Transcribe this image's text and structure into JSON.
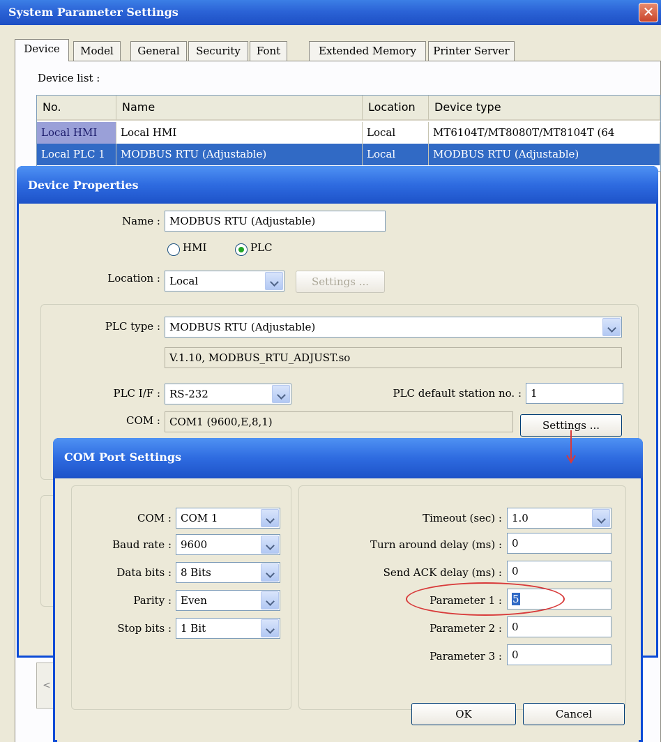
{
  "window": {
    "title": "System Parameter Settings",
    "close_glyph": "✕",
    "tabs": [
      "Device",
      "Model",
      "General",
      "Security",
      "Font",
      "Extended Memory",
      "Printer Server"
    ],
    "active_tab": "Device"
  },
  "device_list": {
    "label": "Device list :",
    "columns": [
      "No.",
      "Name",
      "Location",
      "Device type"
    ],
    "rows": [
      {
        "no": "Local HMI",
        "name": "Local HMI",
        "location": "Local",
        "type": "MT6104T/MT8080T/MT8104T (64"
      },
      {
        "no": "Local PLC 1",
        "name": "MODBUS RTU (Adjustable)",
        "location": "Local",
        "type": "MODBUS RTU (Adjustable)"
      }
    ],
    "scroll_left_glyph": "<"
  },
  "device_properties": {
    "title": "Device Properties",
    "name_label": "Name :",
    "name_value": "MODBUS RTU (Adjustable)",
    "radio_hmi": "HMI",
    "radio_plc": "PLC",
    "selected_radio": "PLC",
    "location_label": "Location :",
    "location_value": "Local",
    "location_settings_button": "Settings ...",
    "plc_type_label": "PLC type :",
    "plc_type_value": "MODBUS RTU (Adjustable)",
    "driver_info": "V.1.10, MODBUS_RTU_ADJUST.so",
    "plc_if_label": "PLC I/F :",
    "plc_if_value": "RS-232",
    "station_label": "PLC default station no. :",
    "station_value": "1",
    "com_label": "COM :",
    "com_value": "COM1 (9600,E,8,1)",
    "com_settings_button": "Settings ..."
  },
  "com_port_settings": {
    "title": "COM Port Settings",
    "left": [
      {
        "label": "COM :",
        "value": "COM 1"
      },
      {
        "label": "Baud rate :",
        "value": "9600"
      },
      {
        "label": "Data bits :",
        "value": "8 Bits"
      },
      {
        "label": "Parity :",
        "value": "Even"
      },
      {
        "label": "Stop bits :",
        "value": "1 Bit"
      }
    ],
    "timeout_label": "Timeout (sec) :",
    "timeout_value": "1.0",
    "turn_around_label": "Turn around delay (ms) :",
    "turn_around_value": "0",
    "send_ack_label": "Send ACK delay (ms) :",
    "send_ack_value": "0",
    "param1_label": "Parameter 1 :",
    "param1_value": "5",
    "param2_label": "Parameter 2 :",
    "param2_value": "0",
    "param3_label": "Parameter 3 :",
    "param3_value": "0",
    "ok_button": "OK",
    "cancel_button": "Cancel"
  },
  "annotation_colors": {
    "highlight": "#d83a3a"
  }
}
